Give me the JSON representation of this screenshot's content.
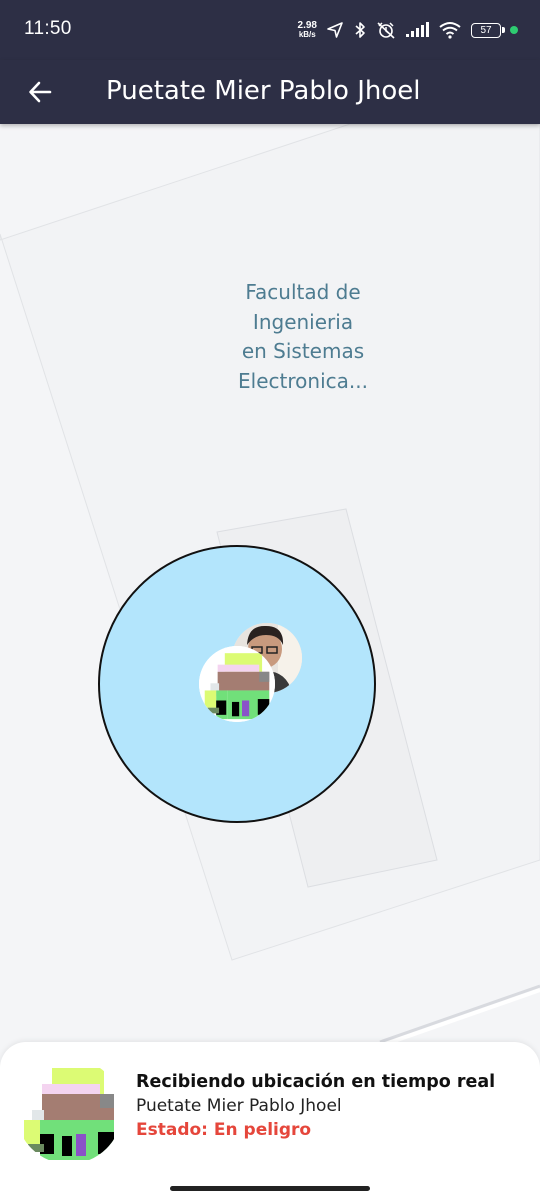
{
  "status_bar": {
    "time": "11:50",
    "net_speed_value": "2.98",
    "net_speed_unit": "kB/s",
    "battery": "57",
    "icons": [
      "location-arrow-icon",
      "bluetooth-icon",
      "alarm-off-icon",
      "signal-icon",
      "wifi-icon",
      "battery-icon",
      "active-dot-icon"
    ],
    "colors": {
      "background": "#2d2f45",
      "active_dot": "#2ecc71"
    }
  },
  "app_bar": {
    "title": "Puetate Mier Pablo Jhoel",
    "back_icon": "arrow-left-icon",
    "background": "#2d2f45"
  },
  "map": {
    "label_lines": [
      "Facultad de",
      "Ingenieria",
      "en Sistemas",
      "Electronica..."
    ],
    "label_color": "#4e7c91",
    "radius_fill": "#b3e5fc"
  },
  "bottom_card": {
    "title": "Recibiendo ubicación en tiempo real",
    "name": "Puetate Mier Pablo Jhoel",
    "status": "Estado: En peligro",
    "status_color": "#e5463b"
  }
}
